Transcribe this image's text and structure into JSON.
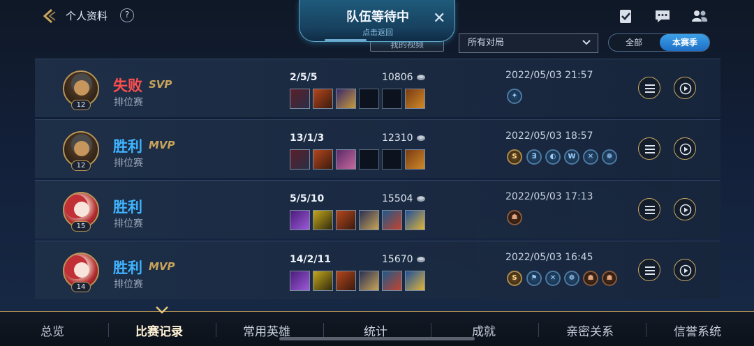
{
  "header": {
    "title": "个人资料",
    "help_symbol": "?",
    "icons": [
      "back-arrow-icon",
      "help-icon",
      "checklist-icon",
      "chat-icon",
      "friends-icon"
    ]
  },
  "team_popup": {
    "title": "队伍等待中",
    "subtitle": "点击返回",
    "close_symbol": "✕"
  },
  "filters": {
    "video_button": "我的视频",
    "match_type": "所有对局",
    "toggle_all": "全部",
    "toggle_season": "本赛季"
  },
  "matches": [
    {
      "result": "失败",
      "result_type": "loss",
      "honor": "SVP",
      "mode": "排位赛",
      "level": "12",
      "kda": "2/5/5",
      "gold": "10806",
      "datetime": "2022/05/03 21:57",
      "badges": [
        "✦"
      ]
    },
    {
      "result": "胜利",
      "result_type": "win",
      "honor": "MVP",
      "mode": "排位赛",
      "level": "12",
      "kda": "13/1/3",
      "gold": "12310",
      "datetime": "2022/05/03 18:57",
      "badges": [
        "S",
        "∃",
        "◐",
        "W",
        "✕",
        "❁"
      ]
    },
    {
      "result": "胜利",
      "result_type": "win",
      "honor": "",
      "mode": "排位赛",
      "level": "15",
      "kda": "5/5/10",
      "gold": "15504",
      "datetime": "2022/05/03 17:13",
      "badges": [
        "☗"
      ]
    },
    {
      "result": "胜利",
      "result_type": "win",
      "honor": "MVP",
      "mode": "排位赛",
      "level": "14",
      "kda": "14/2/11",
      "gold": "15670",
      "datetime": "2022/05/03 16:45",
      "badges": [
        "S",
        "⚑",
        "✕",
        "❁",
        "☗",
        "☗"
      ]
    }
  ],
  "bottom_nav": {
    "tabs": [
      "总览",
      "比赛记录",
      "常用英雄",
      "统计",
      "成就",
      "亲密关系",
      "信誉系统"
    ],
    "active": "比赛记录"
  },
  "colors": {
    "loss": "#ff4e4e",
    "win": "#3fb4ff",
    "honor": "#c9a45a",
    "accent_blue": "#2a86d8",
    "gold_border": "#b99556"
  }
}
